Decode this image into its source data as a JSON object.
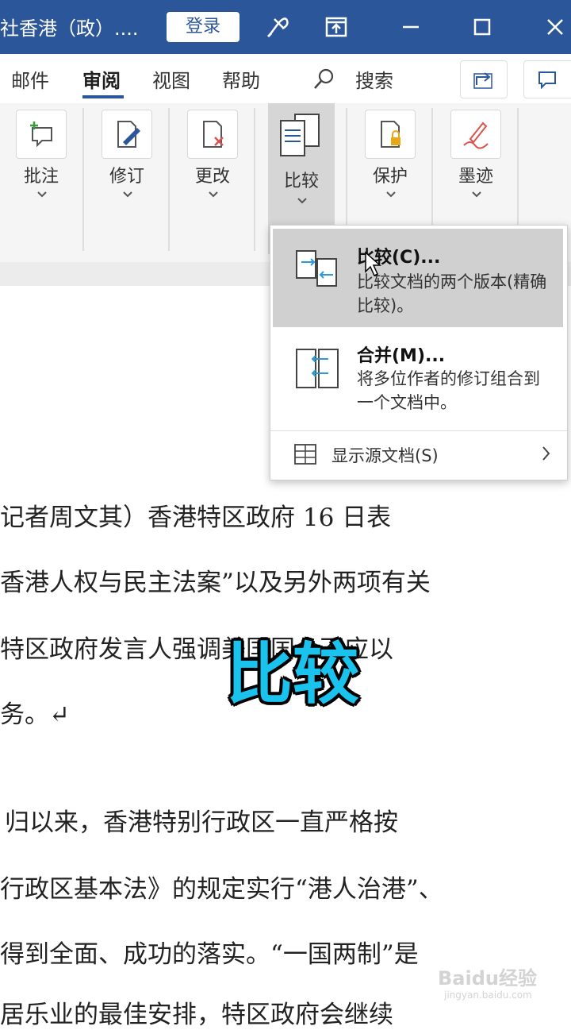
{
  "titlebar": {
    "doc_title": "社香港（政）....",
    "login_label": "登录",
    "icons": [
      "lightbulb-icon",
      "ribbon-display-icon",
      "minimize-icon",
      "maximize-icon",
      "close-icon"
    ]
  },
  "tabs": {
    "items": [
      "邮件",
      "审阅",
      "视图",
      "帮助"
    ],
    "active": "审阅",
    "search_label": "搜索"
  },
  "ribbon": {
    "groups": [
      {
        "label": "批注",
        "icon": "comment-icon"
      },
      {
        "label": "修订",
        "icon": "track-changes-icon"
      },
      {
        "label": "更改",
        "icon": "changes-icon"
      },
      {
        "label": "比较",
        "icon": "compare-icon"
      },
      {
        "label": "保护",
        "icon": "protect-icon"
      },
      {
        "label": "墨迹",
        "icon": "ink-icon"
      }
    ]
  },
  "dropdown": {
    "compare": {
      "title": "比较(C)...",
      "desc": "比较文档的两个版本(精确比较)。"
    },
    "merge": {
      "title": "合并(M)...",
      "desc": "将多位作者的修订组合到一个文档中。"
    },
    "show_source": {
      "label": "显示源文档(S)"
    }
  },
  "document": {
    "lines": [
      "记者周文其）香港特区政府 16 日表",
      "香港人权与民主法案”以及另外两项有关",
      "特区政府发言人强调美国国会不应以",
      "务。↵",
      "归以来，香港特别行政区一直严格按",
      "行政区基本法》的规定实行“港人治港”、",
      "得到全面、成功的落实。“一国两制”是",
      "居乐业的最佳安排，特区政府会继续"
    ]
  },
  "overlay": {
    "caption": "比较"
  },
  "watermark": {
    "text": "Baidu经验",
    "sub": "jingyan.baidu.com"
  },
  "colors": {
    "title_bar": "#2b579a",
    "overlay_text": "#19c3ee"
  }
}
